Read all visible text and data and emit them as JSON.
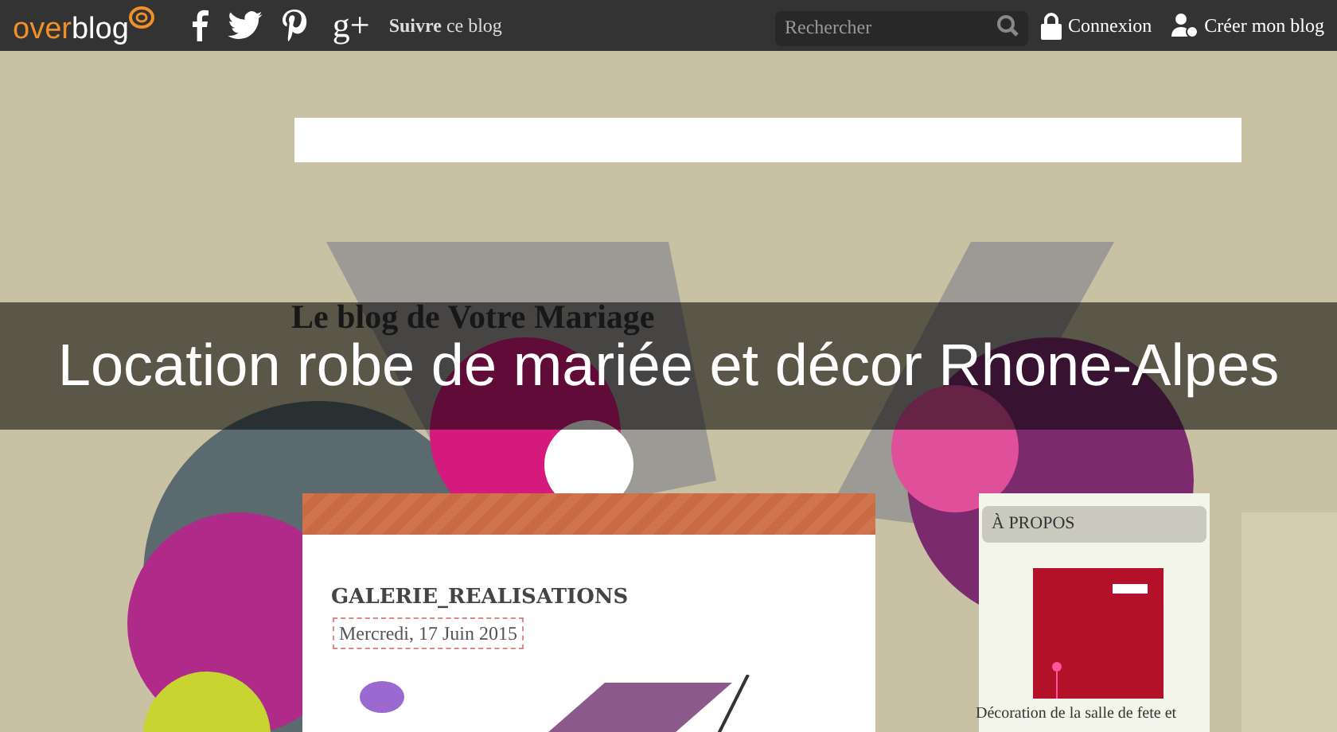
{
  "top_bar": {
    "logo": {
      "accent": "over",
      "rest": "blog"
    },
    "share_icons": [
      {
        "kind": "facebook"
      },
      {
        "kind": "twitter"
      },
      {
        "kind": "pinterest"
      },
      {
        "kind": "gplus",
        "text": "g+"
      }
    ],
    "follow": "**Suivre** ce blog",
    "search": {
      "placeholder": "Rechercher"
    },
    "links": [
      {
        "kind": "lock",
        "label": "Connexion"
      },
      {
        "kind": "user",
        "label": "Créer mon blog"
      }
    ]
  },
  "blog_name": "Le blog de Votre Mariage",
  "page_title": "Location robe de mariée et décor Rhone-Alpes",
  "post": {
    "title": "GALERIE_REALISATIONS",
    "date": "Mercredi, 17 Juin 2015"
  },
  "sidebar": {
    "heading": "À PROPOS",
    "text": "Décoration de la salle de fete et"
  }
}
